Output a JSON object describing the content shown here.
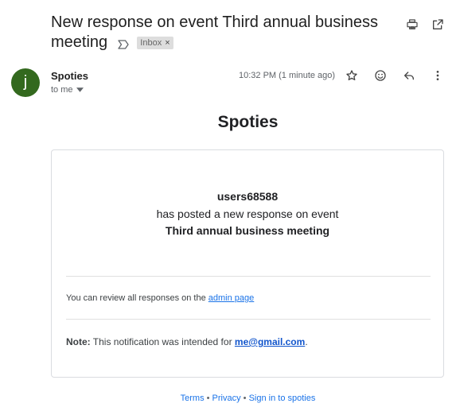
{
  "subject": {
    "title": "New response on event Third annual business meeting",
    "label": "Inbox",
    "label_close": "×"
  },
  "sender": {
    "avatar_letter": "j",
    "name": "Spoties",
    "to": "to me",
    "time": "10:32 PM (1 minute ago)"
  },
  "email": {
    "brand": "Spoties",
    "user": "users68588",
    "action": "has posted a new response on event",
    "event": "Third annual business meeting",
    "review_text": "You can review all responses on the",
    "review_link": "admin page",
    "note_label": "Note:",
    "note_text": "This notification was intended for",
    "note_email": "me@gmail.com",
    "note_end": "."
  },
  "footer": {
    "terms": "Terms",
    "sep1": " • ",
    "privacy": "Privacy",
    "sep2": " • ",
    "signin": "Sign in to spoties"
  },
  "icons": {
    "print": "printer-icon",
    "external": "open-in-new-window-icon",
    "importance": "importance-marker-icon",
    "star": "star-icon",
    "emoji": "emoji-reaction-icon",
    "reply": "reply-icon",
    "more": "more-vert-icon",
    "dropdown": "caret-down-icon"
  },
  "colors": {
    "avatar_bg": "#33691e",
    "link": "#1a73e8"
  }
}
